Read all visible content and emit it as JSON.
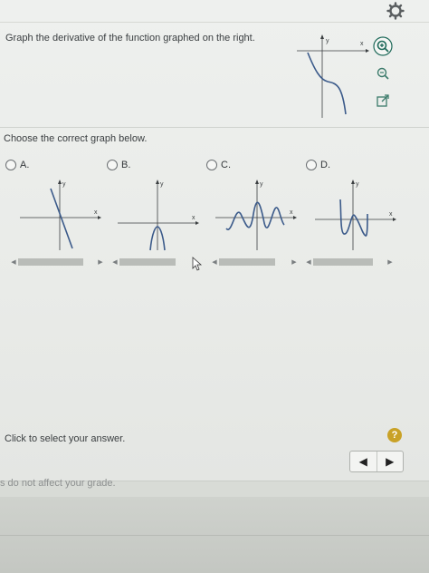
{
  "question": {
    "text": "Graph the derivative of the function graphed on the right."
  },
  "given_graph": {
    "x_label": "x",
    "y_label": "y"
  },
  "tools": {
    "zoom_in": "zoom-in-icon",
    "zoom_out": "zoom-out-icon",
    "popout": "popout-icon",
    "settings": "gear-icon"
  },
  "choices": {
    "prompt": "Choose the correct graph below.",
    "options": [
      {
        "label": "A.",
        "x_label": "x",
        "y_label": "y"
      },
      {
        "label": "B.",
        "x_label": "x",
        "y_label": "y"
      },
      {
        "label": "C.",
        "x_label": "x",
        "y_label": "y"
      },
      {
        "label": "D.",
        "x_label": "x",
        "y_label": "y"
      }
    ]
  },
  "footer": {
    "instruction": "Click to select your answer.",
    "help": "?",
    "nav_prev": "◀",
    "nav_next": "▶",
    "cut_text": "s do not affect your grade."
  },
  "colors": {
    "curve": "#3b5a8a",
    "axis": "#3a3e40",
    "help_bg": "#c9a227"
  }
}
